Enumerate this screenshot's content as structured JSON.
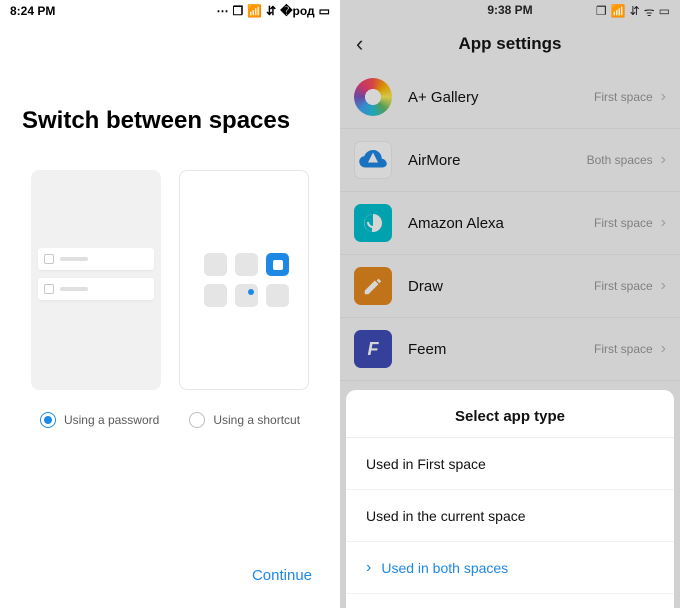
{
  "left": {
    "status_time": "8:24 PM",
    "title": "Switch between spaces",
    "radio_password": "Using a password",
    "radio_shortcut": "Using a shortcut",
    "selected_radio": "password",
    "continue": "Continue"
  },
  "right": {
    "status_time": "9:38 PM",
    "header_title": "App settings",
    "apps": [
      {
        "name": "A+ Gallery",
        "space": "First space"
      },
      {
        "name": "AirMore",
        "space": "Both spaces"
      },
      {
        "name": "Amazon Alexa",
        "space": "First space"
      },
      {
        "name": "Draw",
        "space": "First space"
      },
      {
        "name": "Feem",
        "space": "First space"
      }
    ],
    "sheet": {
      "title": "Select app type",
      "opt_first": "Used in First space",
      "opt_current": "Used in the current space",
      "opt_both": "Used in both spaces",
      "selected": "both"
    }
  }
}
